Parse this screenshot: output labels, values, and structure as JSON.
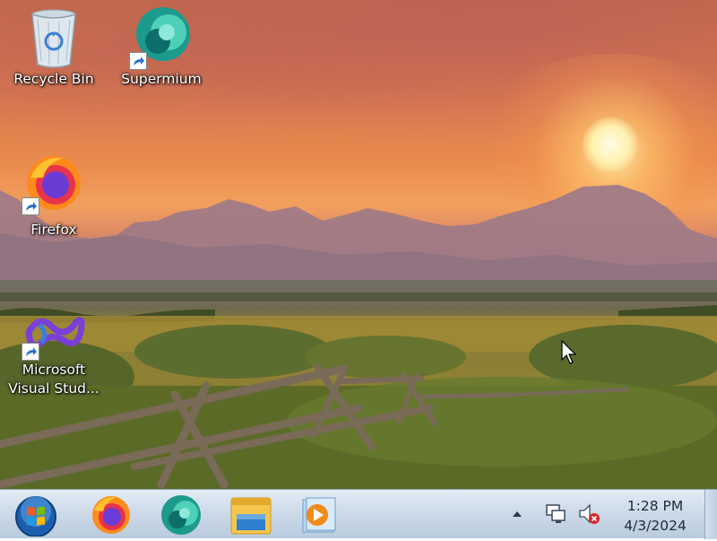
{
  "desktop": {
    "icons": [
      {
        "label": "Recycle Bin",
        "icon": "recycle-bin-icon"
      },
      {
        "label": "Supermium",
        "icon": "supermium-icon",
        "shortcut": true
      },
      {
        "label": "Firefox",
        "icon": "firefox-icon",
        "shortcut": true
      },
      {
        "label": "Microsoft Visual Stud...",
        "label_line1": "Microsoft",
        "label_line2": "Visual Stud...",
        "icon": "visual-studio-icon",
        "shortcut": true
      }
    ]
  },
  "taskbar": {
    "start": {
      "icon": "windows-start-orb-icon"
    },
    "pinned": [
      {
        "name": "Firefox",
        "icon": "firefox-icon"
      },
      {
        "name": "Supermium",
        "icon": "supermium-icon"
      },
      {
        "name": "Windows Explorer",
        "icon": "folder-explorer-icon"
      },
      {
        "name": "Windows Media Player",
        "icon": "media-player-icon"
      }
    ],
    "tray": {
      "icons": [
        "show-hidden-icons-arrow-icon",
        "network-icon",
        "volume-muted-icon"
      ],
      "time": "1:28 PM",
      "date": "4/3/2024"
    }
  },
  "colors": {
    "taskbar_top": "#e3ecf5",
    "taskbar_bottom": "#b9cbdd",
    "sky": "#e98a4e",
    "sun": "#fff2b0"
  }
}
